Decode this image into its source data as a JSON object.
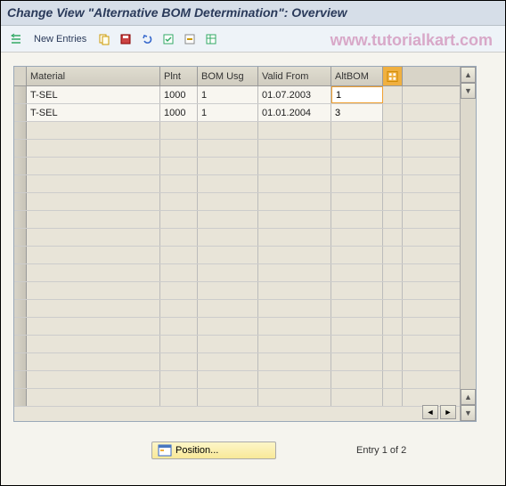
{
  "header": {
    "title": "Change View \"Alternative BOM Determination\": Overview"
  },
  "toolbar": {
    "new_entries": "New Entries"
  },
  "watermark": "www.tutorialkart.com",
  "table": {
    "columns": {
      "material": "Material",
      "plnt": "Plnt",
      "bom_usg": "BOM Usg",
      "valid_from": "Valid From",
      "altbom": "AltBOM"
    },
    "rows": [
      {
        "material": "T-SEL",
        "plnt": "1000",
        "bom_usg": "1",
        "valid_from": "01.07.2003",
        "altbom": "1"
      },
      {
        "material": "T-SEL",
        "plnt": "1000",
        "bom_usg": "1",
        "valid_from": "01.01.2004",
        "altbom": "3"
      }
    ]
  },
  "footer": {
    "position_label": "Position...",
    "entry_info": "Entry 1 of 2"
  }
}
